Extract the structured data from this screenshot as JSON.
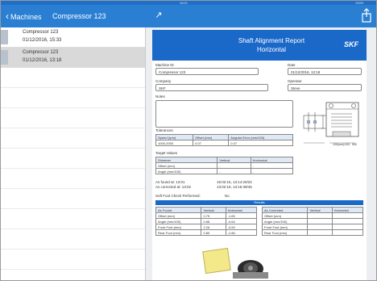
{
  "nav": {
    "back_label": "Machines",
    "breadcrumb": "Compressor 123",
    "status_time": "16:01",
    "status_battery": "100%"
  },
  "sidebar": {
    "items": [
      {
        "title": "Compressor 123",
        "date": "01/12/2016, 15:33",
        "selected": false
      },
      {
        "title": "Compressor 123",
        "date": "01/12/2016, 13:18",
        "selected": true
      }
    ]
  },
  "report": {
    "title_line1": "Shaft Alignment Report",
    "title_line2": "Horizontal",
    "logo": "SKF",
    "machine_id_label": "Machine ID",
    "machine_id": "Compressor 123",
    "date_label": "Date",
    "date": "01/12/2016, 13:18",
    "company_label": "Company",
    "company": "SKF",
    "operator_label": "Operator",
    "operator": "Steve",
    "notes_label": "Notes",
    "tolerances_label": "Tolerances",
    "tolerances": {
      "headers": [
        "Speed (rpm)",
        "Offset (mm)",
        "Angular Error (mm/100)"
      ],
      "row": [
        "1000-2000",
        "0.07",
        "0.07"
      ]
    },
    "target_values_label": "Target Values",
    "target_values": {
      "headers": [
        "Shimmer",
        "Vertical",
        "Horizontal"
      ],
      "rows": [
        [
          "Offset (mm)",
          "-",
          "-"
        ],
        [
          "Angle (mm/100)",
          "-",
          "-"
        ]
      ]
    },
    "as_found_time_label": "As found at: 13:01",
    "as_found_time": "15:02:15, 13:14:20/22",
    "as_corrected_time_label": "As corrected at: 13:02",
    "as_corrected_time": "13:02:18, 13:16:39/45",
    "soft_foot_label": "Soft Foot Check Performed:",
    "soft_foot_value": "No",
    "results_bar": "Results",
    "as_found": {
      "headers": [
        "As Found",
        "Vertical",
        "Horizontal"
      ],
      "rows": [
        [
          "Offset (mm)",
          "0.75",
          "-1.65"
        ],
        [
          "Angle (mm/100)",
          "0.68",
          "-0.64"
        ],
        [
          "Front Foot (mm)",
          "2.26",
          "-0.59"
        ],
        [
          "Rear Foot (mm)",
          "0.89",
          "-2.86"
        ]
      ]
    },
    "as_corrected": {
      "headers": [
        "As Corrected",
        "Vertical",
        "Horizontal"
      ],
      "rows": [
        [
          "Offset (mm)",
          "",
          ""
        ],
        [
          "Angle (mm/100)",
          "",
          ""
        ],
        [
          "Front Foot (mm)",
          "",
          ""
        ],
        [
          "Rear Foot (mm)",
          "",
          ""
        ]
      ]
    },
    "diagram_captions": [
      "100(mm)/100",
      "500"
    ]
  },
  "colors": {
    "nav_blue": "#2a7fd3",
    "header_blue": "#1a68c8",
    "selected_row": "#d9d9d9"
  }
}
